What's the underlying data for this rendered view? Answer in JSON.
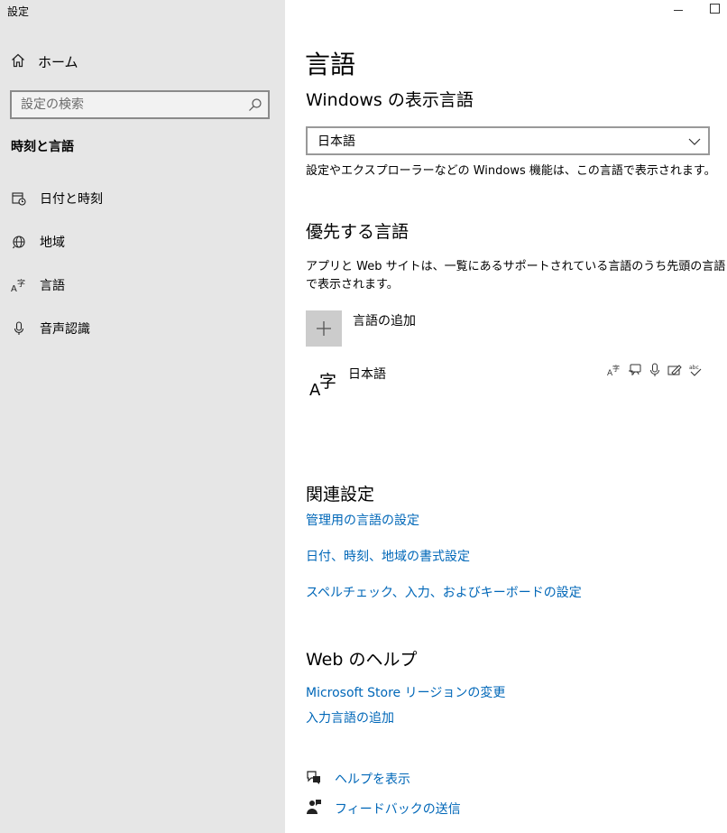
{
  "window": {
    "title": "設定"
  },
  "sidebar": {
    "home_label": "ホーム",
    "search_placeholder": "設定の検索",
    "section_title": "時刻と言語",
    "items": [
      {
        "label": "日付と時刻",
        "icon": "calendar-clock-icon"
      },
      {
        "label": "地域",
        "icon": "globe-icon"
      },
      {
        "label": "言語",
        "icon": "language-icon"
      },
      {
        "label": "音声認識",
        "icon": "microphone-icon"
      }
    ]
  },
  "main": {
    "page_title": "言語",
    "display_language": {
      "heading": "Windows の表示言語",
      "selected": "日本語",
      "description": "設定やエクスプローラーなどの Windows 機能は、この言語で表示されます。"
    },
    "preferred": {
      "heading": "優先する言語",
      "description_line1": "アプリと Web サイトは、一覧にあるサポートされている言語のうち先頭の言語",
      "description_line2": "で表示されます。",
      "add_label": "言語の追加",
      "languages": [
        {
          "name": "日本語",
          "glyph": "字",
          "glyph_latin": "A"
        }
      ]
    },
    "related": {
      "heading": "関連設定",
      "links": [
        "管理用の言語の設定",
        "日付、時刻、地域の書式設定",
        "スペルチェック、入力、およびキーボードの設定"
      ]
    },
    "help": {
      "heading": "Web のヘルプ",
      "links": [
        "Microsoft Store リージョンの変更",
        "入力言語の追加"
      ]
    },
    "footer": {
      "help_label": "ヘルプを表示",
      "feedback_label": "フィードバックの送信"
    }
  },
  "colors": {
    "sidebar_bg": "#e6e6e6",
    "link": "#0067b8",
    "add_button_bg": "#cccccc"
  }
}
